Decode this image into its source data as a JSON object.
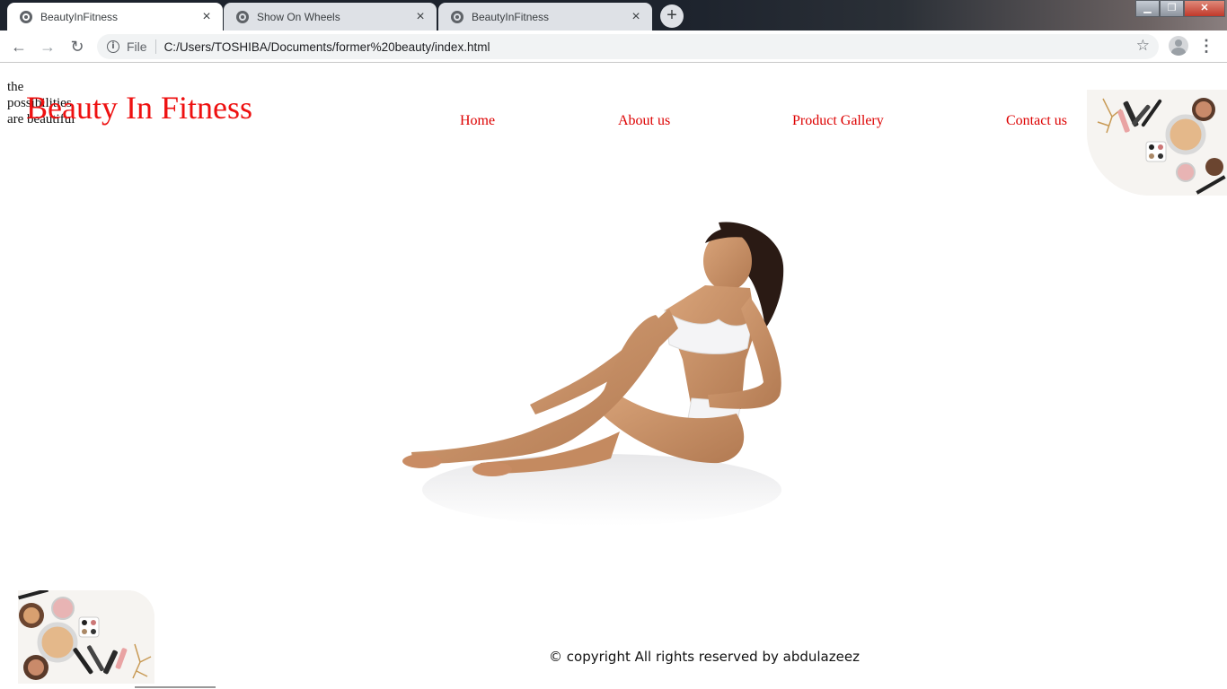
{
  "browser": {
    "tabs": [
      {
        "title": "BeautyInFitness",
        "active": true
      },
      {
        "title": "Show On Wheels",
        "active": false
      },
      {
        "title": "BeautyInFitness",
        "active": false
      }
    ],
    "new_tab": "+",
    "close_glyph": "×",
    "address": {
      "scheme": "File",
      "url": "C:/Users/TOSHIBA/Documents/former%20beauty/index.html"
    },
    "icons": [
      "back-icon",
      "forward-icon",
      "reload-icon",
      "info-icon",
      "star-icon",
      "profile-icon",
      "menu-icon"
    ],
    "window_controls": [
      "minimize",
      "restore",
      "close"
    ]
  },
  "site": {
    "tagline": "the possibilities are beautiful",
    "brand": "Beauty In Fitness",
    "nav": [
      "Home",
      "About us",
      "Product Gallery",
      "Contact us"
    ],
    "footer": "© copyright All rights reserved by abdulazeez",
    "colors": {
      "brand": "#ee1111",
      "nav": "#dd0000"
    }
  }
}
